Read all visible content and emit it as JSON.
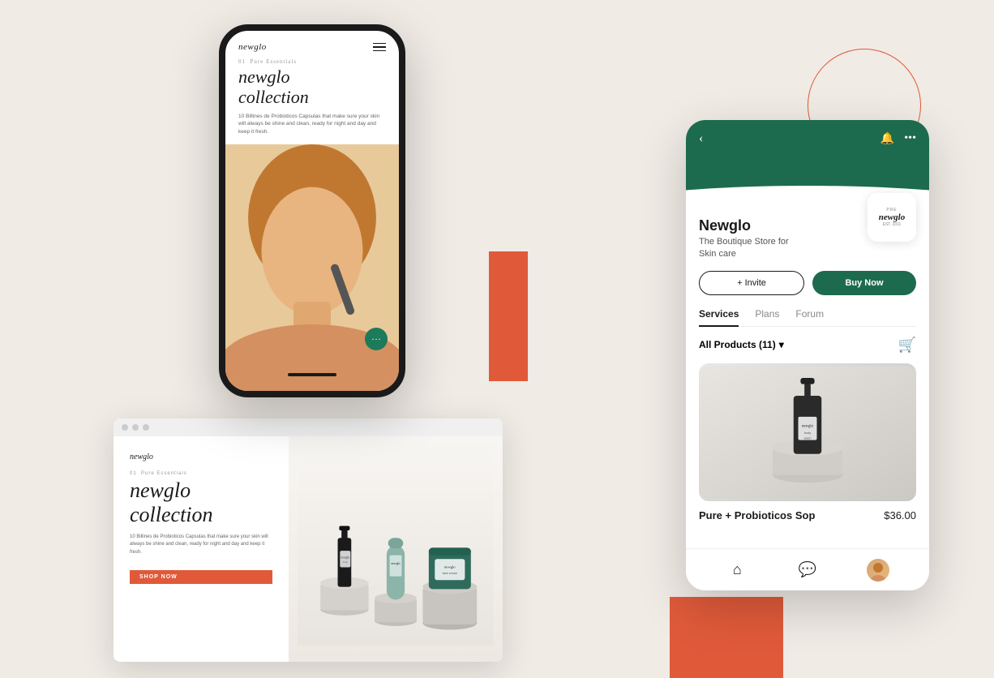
{
  "background_color": "#f0ebe5",
  "decorative": {
    "circle_color": "#e05a3a",
    "orange_color": "#e05a3a"
  },
  "phone": {
    "brand": "newglo",
    "step_label": "01",
    "step_name": "Pure Essentials",
    "title": "newglo\ncollection",
    "description": "10 Billines de Probioticos Capsulas that make sure your skin will always be shine and clean, ready for night and day and keep it fresh.",
    "fab_icon": "···"
  },
  "mobile_app": {
    "back_label": "‹",
    "bell_label": "🔔",
    "more_label": "•••",
    "brand_name": "Newglo",
    "brand_subtitle_line1": "The Boutique Store for",
    "brand_subtitle_line2": "Skin care",
    "logo_pre": "PRE",
    "logo_name": "newglo",
    "logo_est": "EST. 2011",
    "invite_label": "+ Invite",
    "buy_label": "Buy Now",
    "tabs": [
      {
        "label": "Services",
        "active": true
      },
      {
        "label": "Plans",
        "active": false
      },
      {
        "label": "Forum",
        "active": false
      }
    ],
    "filter_label": "All Products (11)",
    "cart_label": "🛒",
    "product_name": "Pure + Probioticos Sop",
    "product_price": "$36.00",
    "product_label": "newglo",
    "nav_home": "🏠",
    "nav_chat": "💬"
  },
  "desktop": {
    "brand": "newglo",
    "step_number": "01",
    "step_name": "Pure Essentials",
    "title": "newglo\ncollection",
    "description": "10 Billines de Probioticos Capsulas that make sure your skin will always be shine and clean, ready for night and day and keep it fresh.",
    "shop_button": "SHOP NOW",
    "product_labels": [
      "newglo",
      "newglo",
      "newglo"
    ]
  }
}
